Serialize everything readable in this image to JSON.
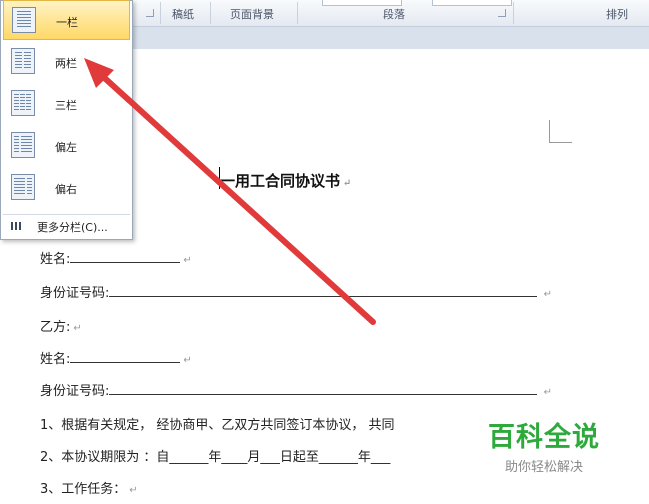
{
  "ribbon": {
    "groups": [
      "稿纸",
      "页面背景",
      "段落",
      "排列"
    ]
  },
  "document": {
    "title": "一用工合同协议书",
    "lines": [
      {
        "label": "姓名:"
      },
      {
        "label": "身份证号码:"
      },
      {
        "label": "乙方:"
      },
      {
        "label": "姓名:"
      },
      {
        "label": "身份证号码:"
      },
      {
        "text": "1、根据有关规定， 经协商甲、乙双方共同签订本协议， 共同"
      },
      {
        "text": "2、本协议期限为 ：自______年____月___日起至______年___"
      },
      {
        "text": "3、工作任务："
      }
    ]
  },
  "columns_menu": {
    "items": [
      {
        "label": "一栏",
        "icon": "one-column-icon"
      },
      {
        "label": "两栏",
        "icon": "two-columns-icon"
      },
      {
        "label": "三栏",
        "icon": "three-columns-icon"
      },
      {
        "label": "偏左",
        "icon": "left-column-icon"
      },
      {
        "label": "偏右",
        "icon": "right-column-icon"
      }
    ],
    "more_label": "更多分栏(C)..."
  },
  "watermark": {
    "main": "百科全说",
    "sub": "助你轻松解决"
  },
  "colors": {
    "arrow": "#e03a3a",
    "watermark_green": "#2eaa3c",
    "selected_bg": "#ffd867"
  }
}
